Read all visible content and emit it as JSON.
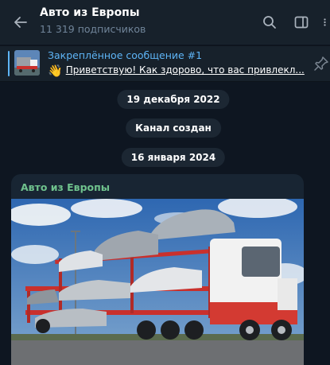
{
  "header": {
    "title": "Авто из Европы",
    "subtitle": "11 319 подписчиков"
  },
  "pinned": {
    "title": "Закреплённое сообщение #1",
    "emoji": "👋",
    "text": "Приветствую!  Как здорово, что вас привлекл..."
  },
  "service": {
    "date1": "19 декабря 2022",
    "created": "Канал создан",
    "date2": "16 января 2024"
  },
  "message": {
    "author": "Авто из Европы"
  },
  "colors": {
    "background": "#0e1621",
    "header": "#17212b",
    "accent": "#5eb5f7",
    "author": "#6fc28d",
    "muted": "#708499"
  }
}
